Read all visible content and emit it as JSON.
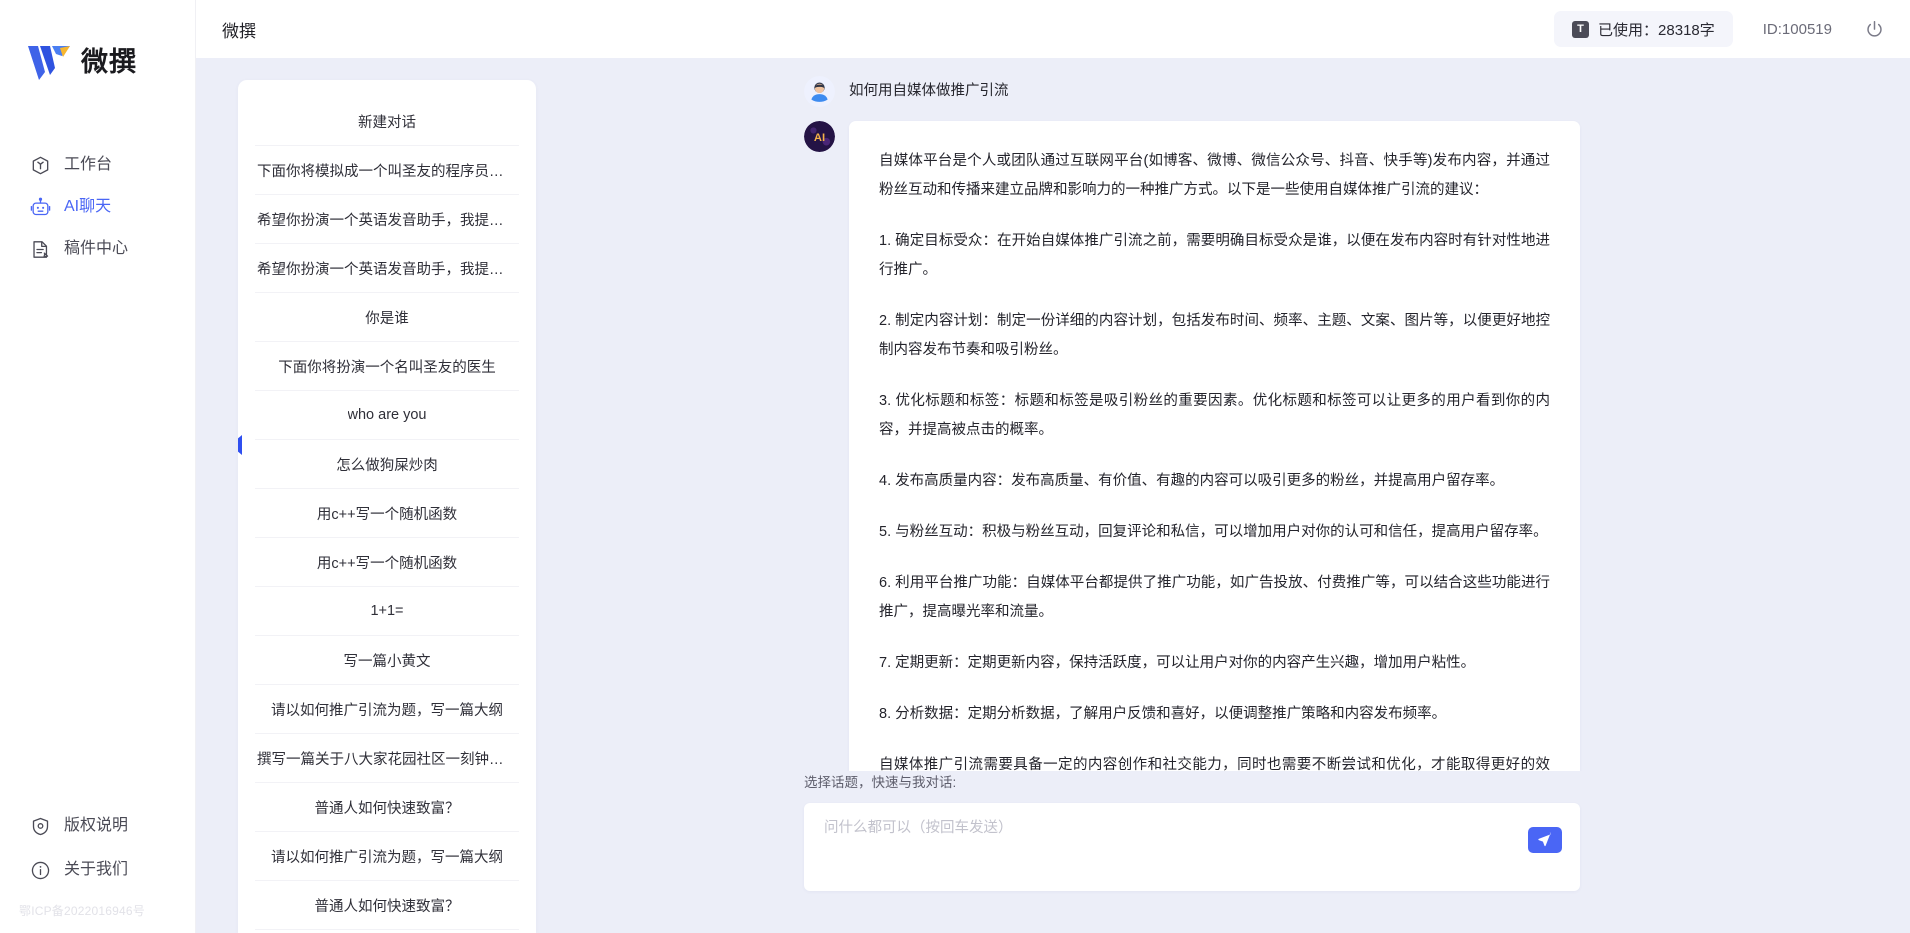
{
  "brand": {
    "name": "微撰",
    "logo_icon": "w-logo-icon"
  },
  "sidebar": {
    "nav": [
      {
        "label": "工作台",
        "icon": "workbench-icon",
        "active": false
      },
      {
        "label": "AI聊天",
        "icon": "ai-chat-icon",
        "active": true
      },
      {
        "label": "稿件中心",
        "icon": "documents-icon",
        "active": false
      }
    ],
    "footer": [
      {
        "label": "版权说明",
        "icon": "shield-icon"
      },
      {
        "label": "关于我们",
        "icon": "info-icon"
      }
    ],
    "icp": "鄂ICP备2022016946号"
  },
  "topbar": {
    "title": "微撰",
    "usage_badge": "T",
    "usage_label": "已使用：28318字",
    "user_id": "ID:100519",
    "power_icon": "power-icon"
  },
  "conversations": {
    "new_chat_label": "新建对话",
    "items": [
      "下面你将模拟成一个叫圣友的程序员，我说...",
      "希望你扮演一个英语发音助手，我提供给你...",
      "希望你扮演一个英语发音助手，我提供给你...",
      "你是谁",
      "下面你将扮演一个名叫圣友的医生",
      "who are you",
      "怎么做狗屎炒肉",
      "用c++写一个随机函数",
      "用c++写一个随机函数",
      "1+1=",
      "写一篇小黄文",
      "请以如何推广引流为题，写一篇大纲",
      "撰写一篇关于八大家花园社区一刻钟便民生...",
      "普通人如何快速致富？",
      "请以如何推广引流为题，写一篇大纲",
      "普通人如何快速致富？"
    ]
  },
  "chat": {
    "user_avatar_icon": "user-avatar",
    "ai_avatar_icon": "ai-avatar",
    "user_message": "如何用自媒体做推广引流",
    "ai_message_paragraphs": [
      "自媒体平台是个人或团队通过互联网平台(如博客、微博、微信公众号、抖音、快手等)发布内容，并通过粉丝互动和传播来建立品牌和影响力的一种推广方式。以下是一些使用自媒体推广引流的建议：",
      "1. 确定目标受众：在开始自媒体推广引流之前，需要明确目标受众是谁，以便在发布内容时有针对性地进行推广。",
      "2. 制定内容计划：制定一份详细的内容计划，包括发布时间、频率、主题、文案、图片等，以便更好地控制内容发布节奏和吸引粉丝。",
      "3. 优化标题和标签：标题和标签是吸引粉丝的重要因素。优化标题和标签可以让更多的用户看到你的内容，并提高被点击的概率。",
      "4. 发布高质量内容：发布高质量、有价值、有趣的内容可以吸引更多的粉丝，并提高用户留存率。",
      "5. 与粉丝互动：积极与粉丝互动，回复评论和私信，可以增加用户对你的认可和信任，提高用户留存率。",
      "6. 利用平台推广功能：自媒体平台都提供了推广功能，如广告投放、付费推广等，可以结合这些功能进行推广，提高曝光率和流量。",
      "7. 定期更新：定期更新内容，保持活跃度，可以让用户对你的内容产生兴趣，增加用户粘性。",
      "8. 分析数据：定期分析数据，了解用户反馈和喜好，以便调整推广策略和内容发布频率。",
      "自媒体推广引流需要具备一定的内容创作和社交能力，同时也需要不断尝试和优化，才能取得更好的效果。"
    ]
  },
  "composer": {
    "label": "选择话题，快速与我对话:",
    "placeholder": "问什么都可以（按回车发送）",
    "value": "",
    "send_icon": "send-plane-icon"
  },
  "colors": {
    "accent": "#4a66f5",
    "page_bg": "#eceef8",
    "panel_bg": "#ffffff"
  }
}
